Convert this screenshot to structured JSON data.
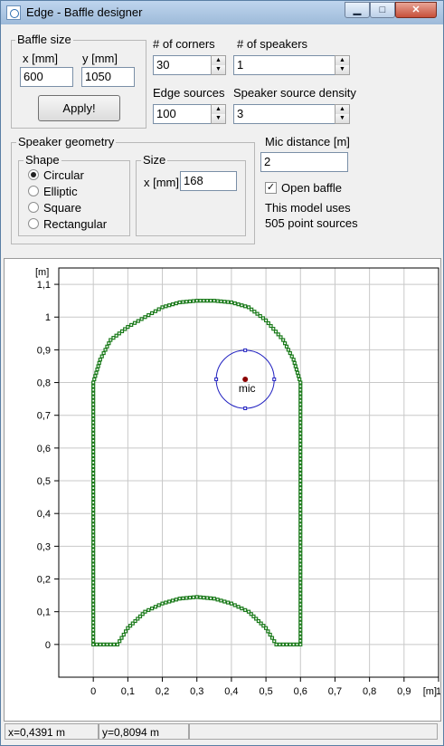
{
  "window": {
    "title": "Edge - Baffle designer",
    "buttons": {
      "minimize": "▁",
      "maximize": "□",
      "close": "✕"
    }
  },
  "baffle_size": {
    "group_label": "Baffle size",
    "x_label": "x [mm]",
    "x_value": "600",
    "y_label": "y [mm]",
    "y_value": "1050",
    "apply_label": "Apply!"
  },
  "corners": {
    "label": "# of corners",
    "value": "30"
  },
  "speakers": {
    "label": "# of speakers",
    "value": "1"
  },
  "edge_sources": {
    "label": "Edge sources",
    "value": "100"
  },
  "speaker_density": {
    "label": "Speaker source density",
    "value": "3"
  },
  "speaker_geometry": {
    "group_label": "Speaker geometry",
    "shape_label": "Shape",
    "shapes": [
      "Circular",
      "Elliptic",
      "Square",
      "Rectangular"
    ],
    "selected_shape": "Circular",
    "size_label": "Size",
    "size_x_label": "x [mm]",
    "size_x_value": "168"
  },
  "mic_distance": {
    "label": "Mic distance [m]",
    "value": "2"
  },
  "open_baffle": {
    "label": "Open baffle",
    "checked": true
  },
  "model_info": {
    "line1": "This model uses",
    "line2": "505 point sources"
  },
  "chart_data": {
    "type": "scatter",
    "x_unit": "[m]",
    "y_unit": "[m]",
    "xlim": [
      -0.1,
      1.0
    ],
    "ylim": [
      -0.1,
      1.15
    ],
    "x_ticks": [
      "0",
      "0,1",
      "0,2",
      "0,3",
      "0,4",
      "0,5",
      "0,6",
      "0,7",
      "0,8",
      "0,9",
      "1"
    ],
    "y_ticks": [
      "0",
      "0,1",
      "0,2",
      "0,3",
      "0,4",
      "0,5",
      "0,6",
      "0,7",
      "0,8",
      "0,9",
      "1",
      "1,1"
    ],
    "grid": true,
    "baffle_outline": [
      [
        0,
        0
      ],
      [
        0.02,
        0
      ],
      [
        0.05,
        0
      ],
      [
        0.07,
        0
      ],
      [
        0.1,
        0.05
      ],
      [
        0.15,
        0.1
      ],
      [
        0.2,
        0.125
      ],
      [
        0.25,
        0.14
      ],
      [
        0.3,
        0.145
      ],
      [
        0.35,
        0.14
      ],
      [
        0.4,
        0.125
      ],
      [
        0.45,
        0.1
      ],
      [
        0.5,
        0.05
      ],
      [
        0.53,
        0
      ],
      [
        0.6,
        0
      ],
      [
        0.6,
        0.8
      ],
      [
        0.58,
        0.87
      ],
      [
        0.55,
        0.93
      ],
      [
        0.5,
        0.99
      ],
      [
        0.45,
        1.03
      ],
      [
        0.4,
        1.045
      ],
      [
        0.35,
        1.05
      ],
      [
        0.3,
        1.05
      ],
      [
        0.25,
        1.045
      ],
      [
        0.2,
        1.03
      ],
      [
        0.15,
        1.0
      ],
      [
        0.1,
        0.97
      ],
      [
        0.05,
        0.93
      ],
      [
        0.02,
        0.87
      ],
      [
        0,
        0.8
      ],
      [
        0,
        0
      ]
    ],
    "mic": {
      "label": "mic",
      "x": 0.44,
      "y": 0.81,
      "radius": 0.084
    }
  },
  "status": {
    "x": "x=0,4391 m",
    "y": "y=0,8094 m"
  }
}
